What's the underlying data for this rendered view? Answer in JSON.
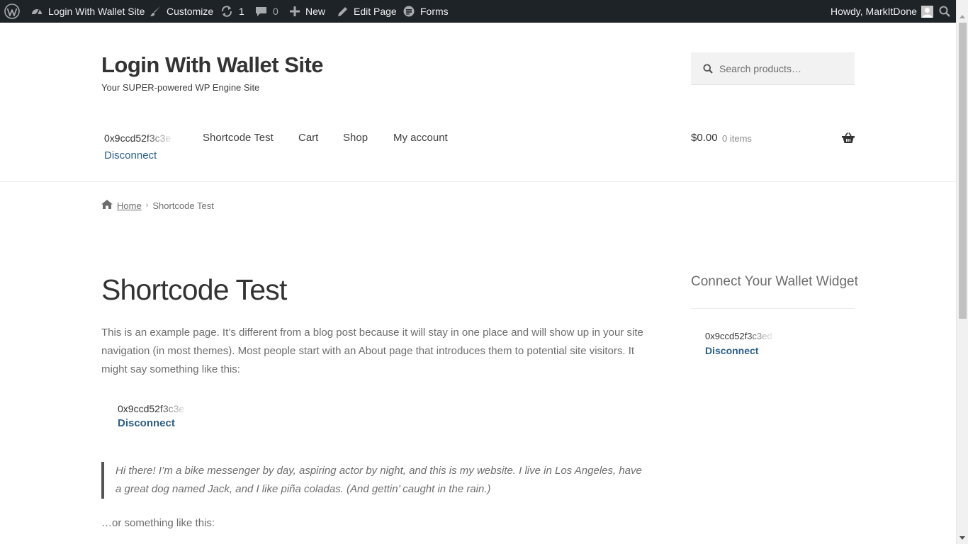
{
  "admin_bar": {
    "site_name": "Login With Wallet Site",
    "customize": "Customize",
    "updates_count": "1",
    "comments_count": "0",
    "new": "New",
    "edit_page": "Edit Page",
    "forms": "Forms",
    "howdy": "Howdy, MarkItDone"
  },
  "header": {
    "site_title": "Login With Wallet Site",
    "tagline": "Your SUPER-powered WP Engine Site",
    "search_placeholder": "Search products…"
  },
  "nav": {
    "wallet_address": "0x9ccd52f3c3e",
    "disconnect": "Disconnect",
    "items": [
      "Shortcode Test",
      "Cart",
      "Shop",
      "My account"
    ]
  },
  "cart": {
    "amount": "$0.00",
    "items": "0 items"
  },
  "breadcrumb": {
    "home": "Home",
    "current": "Shortcode Test"
  },
  "content": {
    "title": "Shortcode Test",
    "paragraph1": "This is an example page. It’s different from a blog post because it will stay in one place and will show up in your site navigation (in most themes). Most people start with an About page that introduces them to potential site visitors. It might say something like this:",
    "wallet_address": "0x9ccd52f3c3e",
    "disconnect": "Disconnect",
    "quote": "Hi there! I’m a bike messenger by day, aspiring actor by night, and this is my website. I live in Los Angeles, have a great dog named Jack, and I like piña coladas. (And gettin’ caught in the rain.)",
    "paragraph2": "…or something like this:"
  },
  "sidebar": {
    "widget_title": "Connect Your Wallet Widget",
    "wallet_address": "0x9ccd52f3c3ed",
    "disconnect": "Disconnect"
  },
  "colors": {
    "admin_bar_bg": "#1d2327",
    "link_blue": "#2c5f88",
    "heading": "#333333",
    "body_text": "#6d6d6d"
  },
  "icons": [
    "wordpress-logo-icon",
    "dashboard-icon",
    "paintbrush-icon",
    "updates-icon",
    "comments-icon",
    "plus-icon",
    "pencil-icon",
    "forms-icon",
    "avatar-icon",
    "search-icon",
    "basket-icon",
    "home-icon"
  ]
}
